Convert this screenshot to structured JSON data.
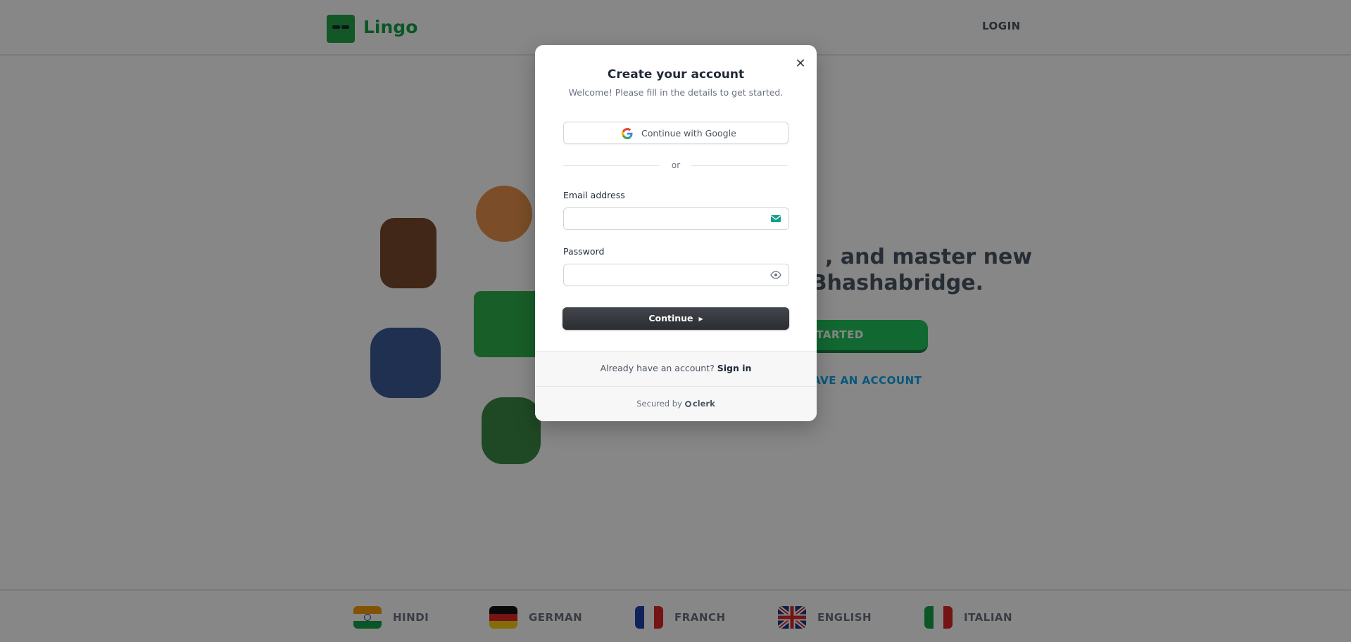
{
  "header": {
    "logo_text": "Lingo",
    "login_label": "LOGIN"
  },
  "hero": {
    "line1": ", and master new",
    "line2": "h Bhashabridge.",
    "get_started_label": "STARTED",
    "have_account_label": "AVE AN ACCOUNT"
  },
  "footer": {
    "languages": [
      {
        "label": "HINDI"
      },
      {
        "label": "GERMAN"
      },
      {
        "label": "FRANCH"
      },
      {
        "label": "ENGLISH"
      },
      {
        "label": "ITALIAN"
      }
    ]
  },
  "modal": {
    "title": "Create your account",
    "subtitle": "Welcome! Please fill in the details to get started.",
    "google_label": "Continue with Google",
    "divider": "or",
    "email_label": "Email address",
    "email_value": "",
    "password_label": "Password",
    "password_value": "",
    "continue_label": "Continue",
    "already_text": "Already have an account?",
    "signin_label": "Sign in",
    "secured_text": "Secured by",
    "clerk_text": "clerk",
    "close_icon": "close-icon",
    "email_icon": "mail-icon",
    "password_icon": "eye-icon"
  },
  "colors": {
    "brand_green": "#16a34a",
    "button_dark": "#2a2d31",
    "overlay": "rgba(0,0,0,0.47)"
  }
}
